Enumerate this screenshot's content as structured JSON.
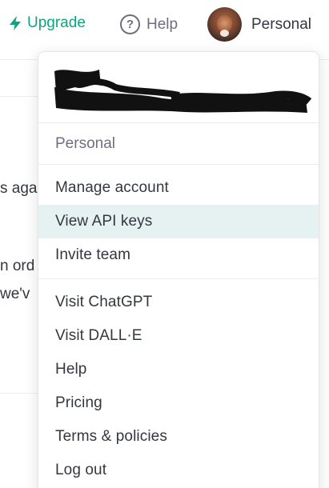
{
  "topbar": {
    "upgrade_label": "Upgrade",
    "help_label": "Help",
    "help_glyph": "?",
    "personal_label": "Personal"
  },
  "background": {
    "line1": "s aga",
    "line2": "n ord",
    "line3": "we'v"
  },
  "dropdown": {
    "section_label": "Personal",
    "group1": [
      "Manage account",
      "View API keys",
      "Invite team"
    ],
    "group2": [
      "Visit ChatGPT",
      "Visit DALL·E",
      "Help",
      "Pricing",
      "Terms & policies",
      "Log out"
    ],
    "active_item": "View API keys"
  },
  "colors": {
    "accent": "#10a37f",
    "muted": "#6e6e80",
    "text": "#353740",
    "highlight": "#e6f2f2"
  },
  "icons": {
    "upgrade": "lightning-bolt-icon",
    "help": "question-circle-icon"
  }
}
